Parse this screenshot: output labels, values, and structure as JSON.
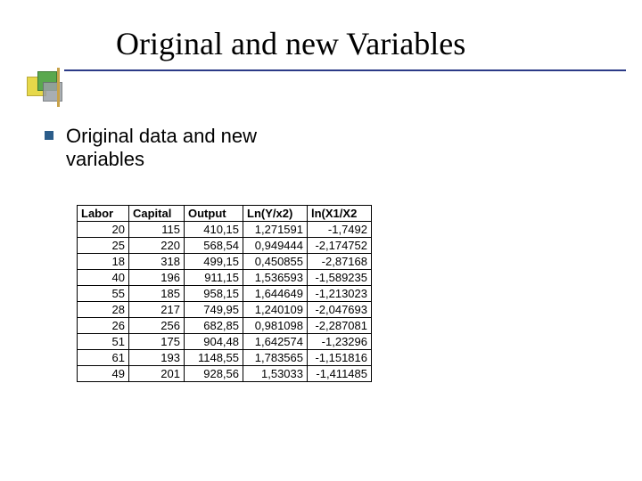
{
  "title": "Original and new Variables",
  "bullet": "Original data and new variables",
  "chart_data": {
    "type": "table",
    "columns": [
      "Labor",
      "Capital",
      "Output",
      "Ln(Y/x2)",
      "ln(X1/X2"
    ],
    "rows": [
      [
        "20",
        "115",
        "410,15",
        "1,271591",
        "-1,7492"
      ],
      [
        "25",
        "220",
        "568,54",
        "0,949444",
        "-2,174752"
      ],
      [
        "18",
        "318",
        "499,15",
        "0,450855",
        "-2,87168"
      ],
      [
        "40",
        "196",
        "911,15",
        "1,536593",
        "-1,589235"
      ],
      [
        "55",
        "185",
        "958,15",
        "1,644649",
        "-1,213023"
      ],
      [
        "28",
        "217",
        "749,95",
        "1,240109",
        "-2,047693"
      ],
      [
        "26",
        "256",
        "682,85",
        "0,981098",
        "-2,287081"
      ],
      [
        "51",
        "175",
        "904,48",
        "1,642574",
        "-1,23296"
      ],
      [
        "61",
        "193",
        "1148,55",
        "1,783565",
        "-1,151816"
      ],
      [
        "49",
        "201",
        "928,56",
        "1,53033",
        "-1,411485"
      ]
    ]
  }
}
